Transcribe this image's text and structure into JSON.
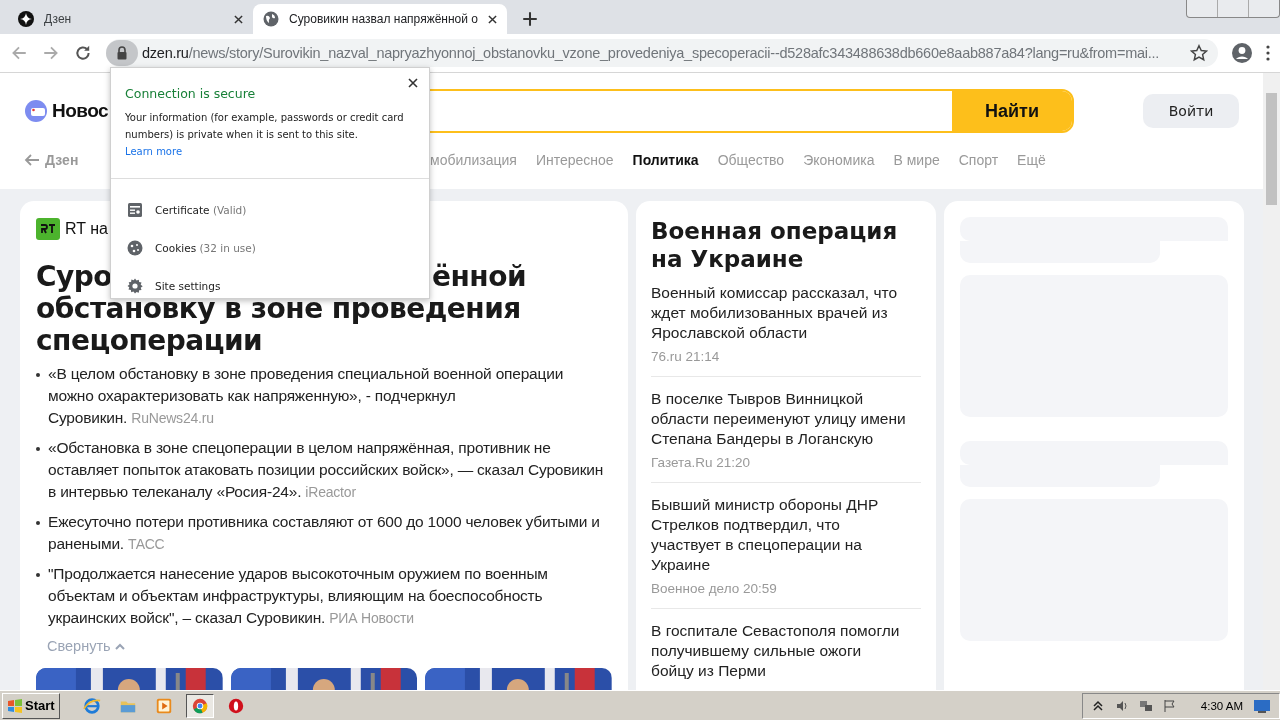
{
  "browser": {
    "tabs": [
      {
        "title": "Дзен",
        "kind": "dzen",
        "selected": false
      },
      {
        "title": "Суровикин назвал напряжённой о",
        "kind": "globe",
        "selected": true
      }
    ],
    "address": {
      "domain": "dzen.ru",
      "path": "/news/story/Surovikin_nazval_napryazhyonnoj_obstanovku_vzone_provedeniya_specoperacii--d528afc343488638db660e8aab887a84?lang=ru&from=mai..."
    }
  },
  "site_info_popup": {
    "title": "Connection is secure",
    "text": "Your information (for example, passwords or credit card numbers) is private when it is sent to this site.",
    "link": "Learn more",
    "items": [
      {
        "kind": "certificate",
        "label": "Certificate",
        "detail": "(Valid)"
      },
      {
        "kind": "cookies",
        "label": "Cookies",
        "detail": "(32 in use)"
      },
      {
        "kind": "settings",
        "label": "Site settings"
      }
    ]
  },
  "header": {
    "logo": "Новос",
    "search_button": "Найти",
    "login_button": "Войти"
  },
  "nav": {
    "back": "Дзен",
    "items": [
      {
        "label": "мобилизация",
        "selected": false
      },
      {
        "label": "Интересное",
        "selected": false
      },
      {
        "label": "Политика",
        "selected": true
      },
      {
        "label": "Общество",
        "selected": false
      },
      {
        "label": "Экономика",
        "selected": false
      },
      {
        "label": "В мире",
        "selected": false
      },
      {
        "label": "Спорт",
        "selected": false
      },
      {
        "label": "Ещё",
        "selected": false
      }
    ]
  },
  "story": {
    "source": "RT на",
    "headline": [
      "Суро",
      "ённой",
      "обстановку в зоне проведения",
      "спецоперации"
    ],
    "quotes": [
      {
        "text": "«В целом обстановку в зоне проведения специальной военной операции можно охарактеризовать как напряженную», - подчеркнул Суровикин.",
        "source": "RuNews24.ru"
      },
      {
        "text": "«Обстановка в зоне спецоперации в целом напряжённая, противник не оставляет попыток атаковать позиции российских войск», — сказал Суровикин в интервью телеканалу «Росия-24».",
        "source": "iReactor"
      },
      {
        "text": "Ежесуточно потери противника составляют от 600 до 1000 человек убитыми и ранеными.",
        "source": "ТАСС"
      },
      {
        "text": "\"Продолжается нанесение ударов высокоточным оружием по военным объектам и объектам инфраструктуры, влияющим на боеспособность украинских войск\", – сказал Суровикин.",
        "source": "РИА Новости"
      }
    ],
    "collapse": "Свернуть",
    "pictures": [
      {
        "kind": "picture"
      },
      {
        "kind": "picture"
      },
      {
        "kind": "picture"
      }
    ]
  },
  "sidebar": {
    "title": "Военная операция на Украине",
    "items": [
      {
        "title": "Военный комиссар рассказал, что ждет мобилизованных врачей из Ярославской области",
        "meta": "76.ru 21:14"
      },
      {
        "title": "В поселке Тывров Винницкой области переименуют улицу имени Степана Бандеры в Логанскую",
        "meta": "Газета.Ru 21:20"
      },
      {
        "title": "Бывший министр обороны ДНР Стрелков подтвердил, что участвует в спецоперации на Украине",
        "meta": "Военное дело 20:59"
      },
      {
        "title": "В госпитале Севастополя помогли получившему сильные ожоги бойцу из Перми"
      }
    ]
  },
  "taskbar": {
    "start": "Start",
    "apps": [
      {
        "kind": "ie",
        "selected": false
      },
      {
        "kind": "folder",
        "selected": false
      },
      {
        "kind": "media",
        "selected": false
      },
      {
        "kind": "chrome",
        "selected": true
      },
      {
        "kind": "opera",
        "selected": false
      }
    ],
    "clock": "4:30 AM"
  }
}
